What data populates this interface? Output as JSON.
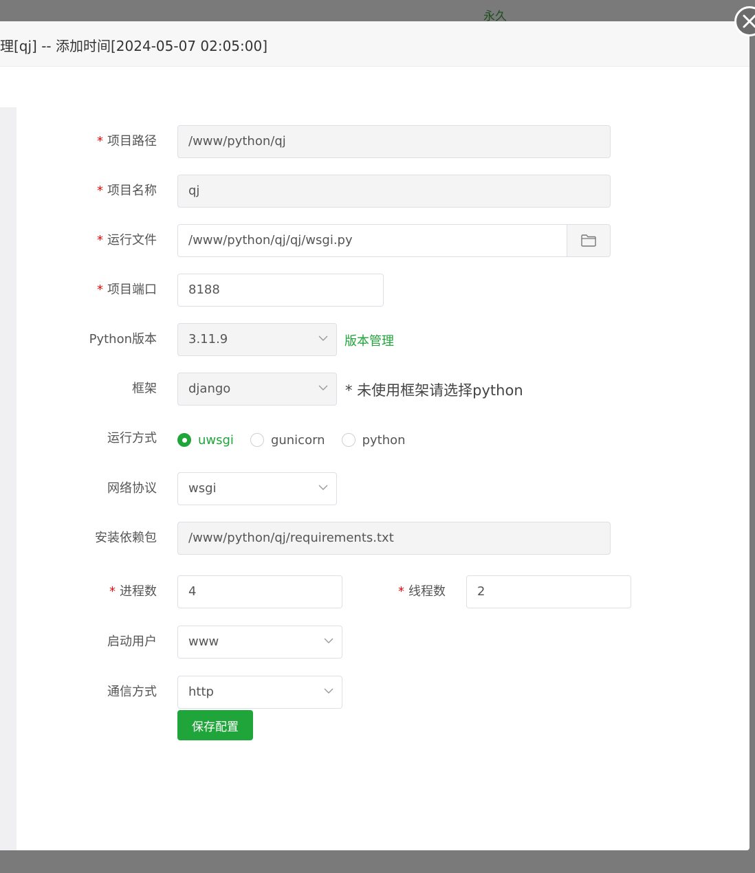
{
  "background": {
    "text": "永久"
  },
  "dialog": {
    "title": "理[qj] -- 添加时间[2024-05-07 02:05:00]"
  },
  "form": {
    "project_path": {
      "label": "项目路径",
      "value": "/www/python/qj"
    },
    "project_name": {
      "label": "项目名称",
      "value": "qj"
    },
    "run_file": {
      "label": "运行文件",
      "value": "/www/python/qj/qj/wsgi.py"
    },
    "project_port": {
      "label": "项目端口",
      "value": "8188"
    },
    "python_version": {
      "label": "Python版本",
      "value": "3.11.9",
      "link": "版本管理"
    },
    "framework": {
      "label": "框架",
      "value": "django",
      "hint": "* 未使用框架请选择python"
    },
    "run_mode": {
      "label": "运行方式",
      "options": [
        "uwsgi",
        "gunicorn",
        "python"
      ],
      "selected": "uwsgi"
    },
    "protocol": {
      "label": "网络协议",
      "value": "wsgi"
    },
    "requirements": {
      "label": "安装依赖包",
      "value": "/www/python/qj/requirements.txt"
    },
    "processes": {
      "label": "进程数",
      "value": "4"
    },
    "threads": {
      "label": "线程数",
      "value": "2"
    },
    "start_user": {
      "label": "启动用户",
      "value": "www"
    },
    "comm_mode": {
      "label": "通信方式",
      "value": "http"
    },
    "save_label": "保存配置"
  },
  "colors": {
    "accent": "#20a53a",
    "required": "#ef0808",
    "overlay": "#7a7a7a"
  },
  "icons": {
    "close": "close-icon",
    "folder": "folder-icon",
    "chevron": "chevron-down-icon"
  }
}
